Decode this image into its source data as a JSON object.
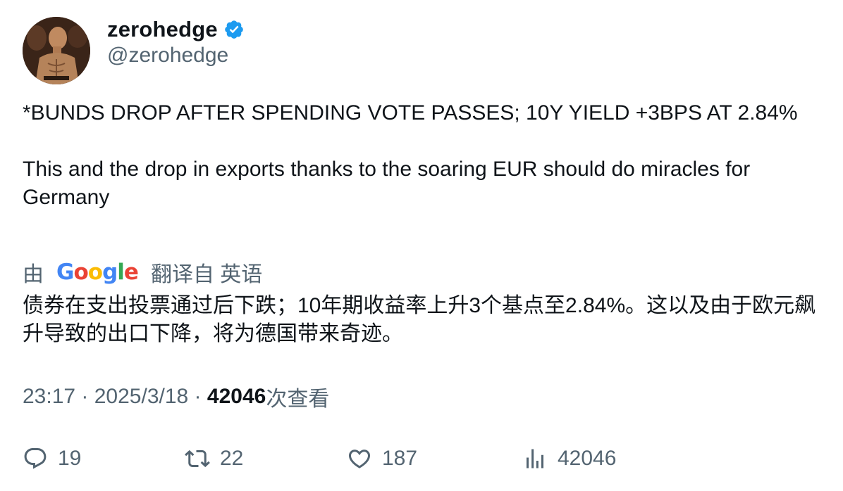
{
  "author": {
    "display_name": "zerohedge",
    "handle": "@zerohedge",
    "verified": true,
    "verified_color": "#1d9bf0"
  },
  "tweet": {
    "paragraphs": [
      "*BUNDS DROP AFTER SPENDING VOTE PASSES; 10Y YIELD +3BPS AT 2.84%",
      "This and the drop in exports thanks to the soaring EUR should do miracles for Germany"
    ]
  },
  "translation": {
    "by_label": "由",
    "provider": "Google",
    "from_label": "翻译自 英语",
    "text": "债券在支出投票通过后下跌；10年期收益率上升3个基点至2.84%。这以及由于欧元飙升导致的出口下降，将为德国带来奇迹。"
  },
  "meta": {
    "time": "23:17",
    "separator": " · ",
    "date": "2025/3/18",
    "views_count": "42046",
    "views_label": "次查看"
  },
  "actions": {
    "reply": {
      "icon": "reply-icon",
      "count": "19"
    },
    "retweet": {
      "icon": "retweet-icon",
      "count": "22"
    },
    "like": {
      "icon": "heart-icon",
      "count": "187"
    },
    "views": {
      "icon": "analytics-icon",
      "count": "42046"
    }
  },
  "colors": {
    "text_primary": "#0f1419",
    "text_secondary": "#536471",
    "google_blue": "#4285F4",
    "google_red": "#EA4335",
    "google_yellow": "#FBBC05",
    "google_green": "#34A853"
  }
}
